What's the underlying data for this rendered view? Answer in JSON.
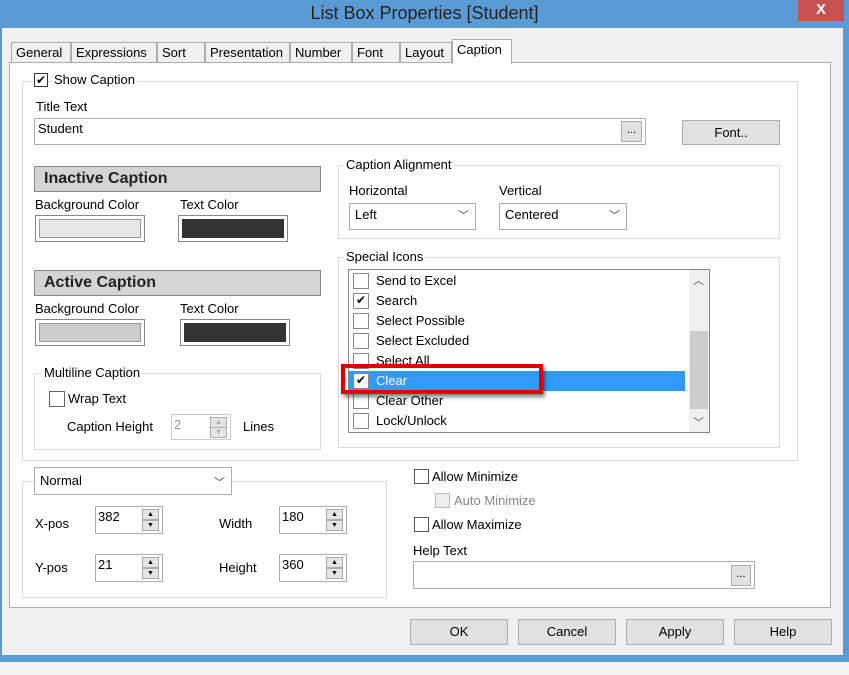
{
  "window": {
    "title": "List Box Properties [Student]",
    "close": "X"
  },
  "tabs": [
    "General",
    "Expressions",
    "Sort",
    "Presentation",
    "Number",
    "Font",
    "Layout",
    "Caption"
  ],
  "show_caption": {
    "label": "Show Caption",
    "checked": true
  },
  "title_text": {
    "label": "Title Text",
    "value": "Student",
    "ellipsis": "...",
    "font_button": "Font.."
  },
  "inactive": {
    "heading": "Inactive Caption",
    "bg_label": "Background Color",
    "text_label": "Text Color",
    "bg_color": "#e6e6e6",
    "text_color": "#333333"
  },
  "active": {
    "heading": "Active Caption",
    "bg_label": "Background Color",
    "text_label": "Text Color",
    "bg_color": "#cccccc",
    "text_color": "#333333"
  },
  "multiline": {
    "legend": "Multiline Caption",
    "wrap_label": "Wrap Text",
    "height_label": "Caption Height",
    "height_value": "2",
    "lines_label": "Lines"
  },
  "alignment": {
    "legend": "Caption Alignment",
    "horizontal_label": "Horizontal",
    "horizontal_value": "Left",
    "vertical_label": "Vertical",
    "vertical_value": "Centered"
  },
  "special_icons": {
    "legend": "Special Icons",
    "items": [
      {
        "label": "Send to Excel",
        "checked": false
      },
      {
        "label": "Search",
        "checked": true
      },
      {
        "label": "Select Possible",
        "checked": false
      },
      {
        "label": "Select Excluded",
        "checked": false
      },
      {
        "label": "Select All",
        "checked": false
      },
      {
        "label": "Clear",
        "checked": true,
        "selected": true
      },
      {
        "label": "Clear Other",
        "checked": false
      },
      {
        "label": "Lock/Unlock",
        "checked": false
      }
    ]
  },
  "position": {
    "mode": "Normal",
    "xpos_label": "X-pos",
    "xpos": "382",
    "ypos_label": "Y-pos",
    "ypos": "21",
    "width_label": "Width",
    "width": "180",
    "height_label": "Height",
    "height": "360"
  },
  "options": {
    "allow_minimize": "Allow Minimize",
    "auto_minimize": "Auto Minimize",
    "allow_maximize": "Allow Maximize",
    "help_label": "Help Text",
    "help_value": "",
    "ellipsis": "..."
  },
  "buttons": {
    "ok": "OK",
    "cancel": "Cancel",
    "apply": "Apply",
    "help": "Help"
  },
  "colors": {
    "highlight": "#3399ff",
    "annotation": "#e00000",
    "titlebar": "#5b9bd5"
  }
}
